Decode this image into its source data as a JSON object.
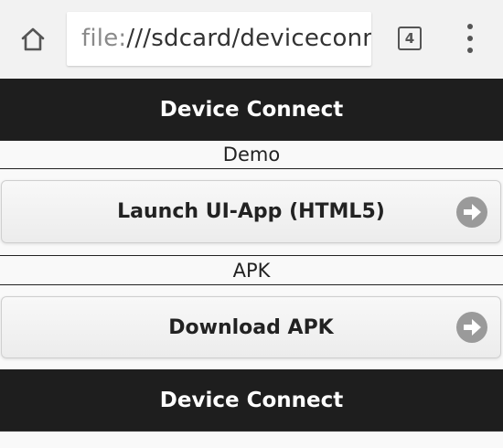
{
  "browser": {
    "url_scheme": "file:",
    "url_rest": "///sdcard/deviceconnect",
    "tab_count": "4",
    "icons": {
      "home": "home-icon",
      "tabs": "tabs-icon",
      "menu": "overflow-menu-icon"
    }
  },
  "page": {
    "header_title": "Device Connect",
    "footer_title": "Device Connect",
    "sections": [
      {
        "divider_label": "Demo",
        "button_label": "Launch UI-App (HTML5)",
        "button_icon": "arrow-right-circle-icon"
      },
      {
        "divider_label": "APK",
        "button_label": "Download APK",
        "button_icon": "arrow-right-circle-icon"
      }
    ]
  },
  "colors": {
    "header_bg": "#1e1e1e",
    "header_text": "#ffffff",
    "arrow_circle": "#9a9a9a"
  }
}
